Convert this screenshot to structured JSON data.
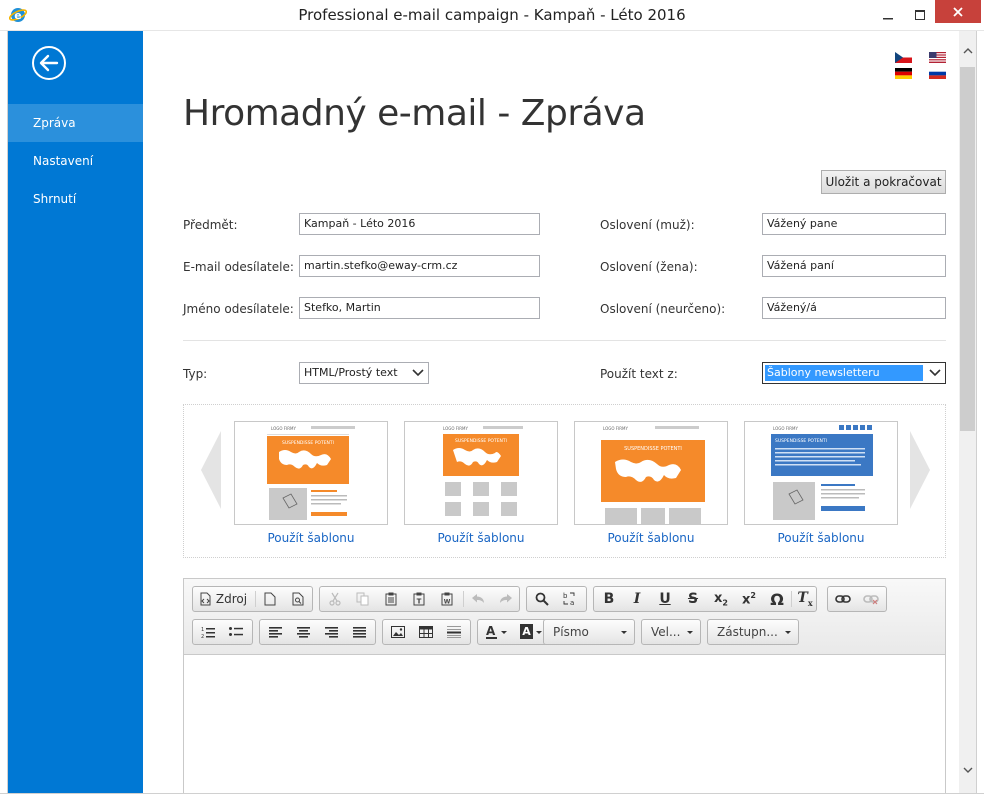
{
  "window": {
    "title": "Professional e-mail campaign - Kampaň - Léto 2016",
    "app_icon": "internet-explorer-icon",
    "close_color": "#c7413b"
  },
  "sidebar": {
    "accent": "#0078d4",
    "active_color": "#2b90dc",
    "back_icon": "arrow-left-circle-icon",
    "items": [
      {
        "label": "Zpráva",
        "active": true
      },
      {
        "label": "Nastavení",
        "active": false
      },
      {
        "label": "Shrnutí",
        "active": false
      }
    ]
  },
  "languages": [
    "cs",
    "en-us",
    "de",
    "ru"
  ],
  "page": {
    "title": "Hromadný e-mail - Zpráva",
    "save_button": "Uložit a pokračovat"
  },
  "form": {
    "subject_label": "Předmět:",
    "subject_value": "Kampaň - Léto 2016",
    "sender_email_label": "E-mail odesílatele:",
    "sender_email_value": "martin.stefko@eway-crm.cz",
    "sender_name_label": "Jméno odesílatele:",
    "sender_name_value": "Stefko, Martin",
    "greeting_male_label": "Oslovení (muž):",
    "greeting_male_value": "Vážený pane",
    "greeting_female_label": "Oslovení (žena):",
    "greeting_female_value": "Vážená paní",
    "greeting_neutral_label": "Oslovení (neurčeno):",
    "greeting_neutral_value": "Vážený/á",
    "type_label": "Typ:",
    "type_value": "HTML/Prostý text",
    "text_from_label": "Použít text z:",
    "text_from_value": "Šablony newsletteru"
  },
  "templates": {
    "use_label": "Použít šablonu",
    "items": [
      {
        "logo": "LOGO FIRMY",
        "banner": "SUSPENDISSE POTENTI",
        "accent": "#f58a2a"
      },
      {
        "logo": "LOGO FIRMY",
        "banner": "SUSPENDISSE POTENTI",
        "accent": "#f58a2a"
      },
      {
        "logo": "LOGO FIRMY",
        "banner": "SUSPENDISSE POTENTI",
        "accent": "#f58a2a"
      },
      {
        "logo": "LOGO FIRMY",
        "banner": "SUSPENDISSE POTENTI",
        "accent": "#3b78c4"
      }
    ]
  },
  "editor": {
    "source_label": "Zdroj",
    "font_label": "Písmo",
    "size_label": "Vel...",
    "placeholder_label": "Zástupn..."
  }
}
